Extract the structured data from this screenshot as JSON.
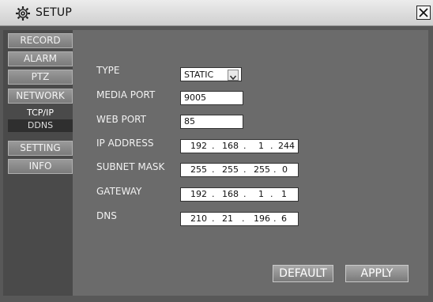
{
  "window": {
    "title": "SETUP",
    "icon": "gear-icon",
    "close_icon": "close-icon"
  },
  "sidebar": {
    "items": [
      {
        "label": "RECORD"
      },
      {
        "label": "ALARM"
      },
      {
        "label": "PTZ"
      },
      {
        "label": "NETWORK"
      },
      {
        "label": "SETTING"
      },
      {
        "label": "INFO"
      }
    ],
    "network_sub": [
      {
        "label": "TCP/IP"
      },
      {
        "label": "DDNS"
      }
    ]
  },
  "form": {
    "type": {
      "label": "TYPE",
      "value": "STATIC"
    },
    "media_port": {
      "label": "MEDIA PORT",
      "value": "9005"
    },
    "web_port": {
      "label": "WEB PORT",
      "value": "85"
    },
    "ip_address": {
      "label": "IP ADDRESS",
      "octets": [
        "192",
        "168",
        "1",
        "244"
      ]
    },
    "subnet_mask": {
      "label": "SUBNET MASK",
      "octets": [
        "255",
        "255",
        "255",
        "0"
      ]
    },
    "gateway": {
      "label": "GATEWAY",
      "octets": [
        "192",
        "168",
        "1",
        "1"
      ]
    },
    "dns": {
      "label": "DNS",
      "octets": [
        "210",
        "21",
        "196",
        "6"
      ]
    }
  },
  "buttons": {
    "default_label": "DEFAULT",
    "apply_label": "APPLY"
  }
}
